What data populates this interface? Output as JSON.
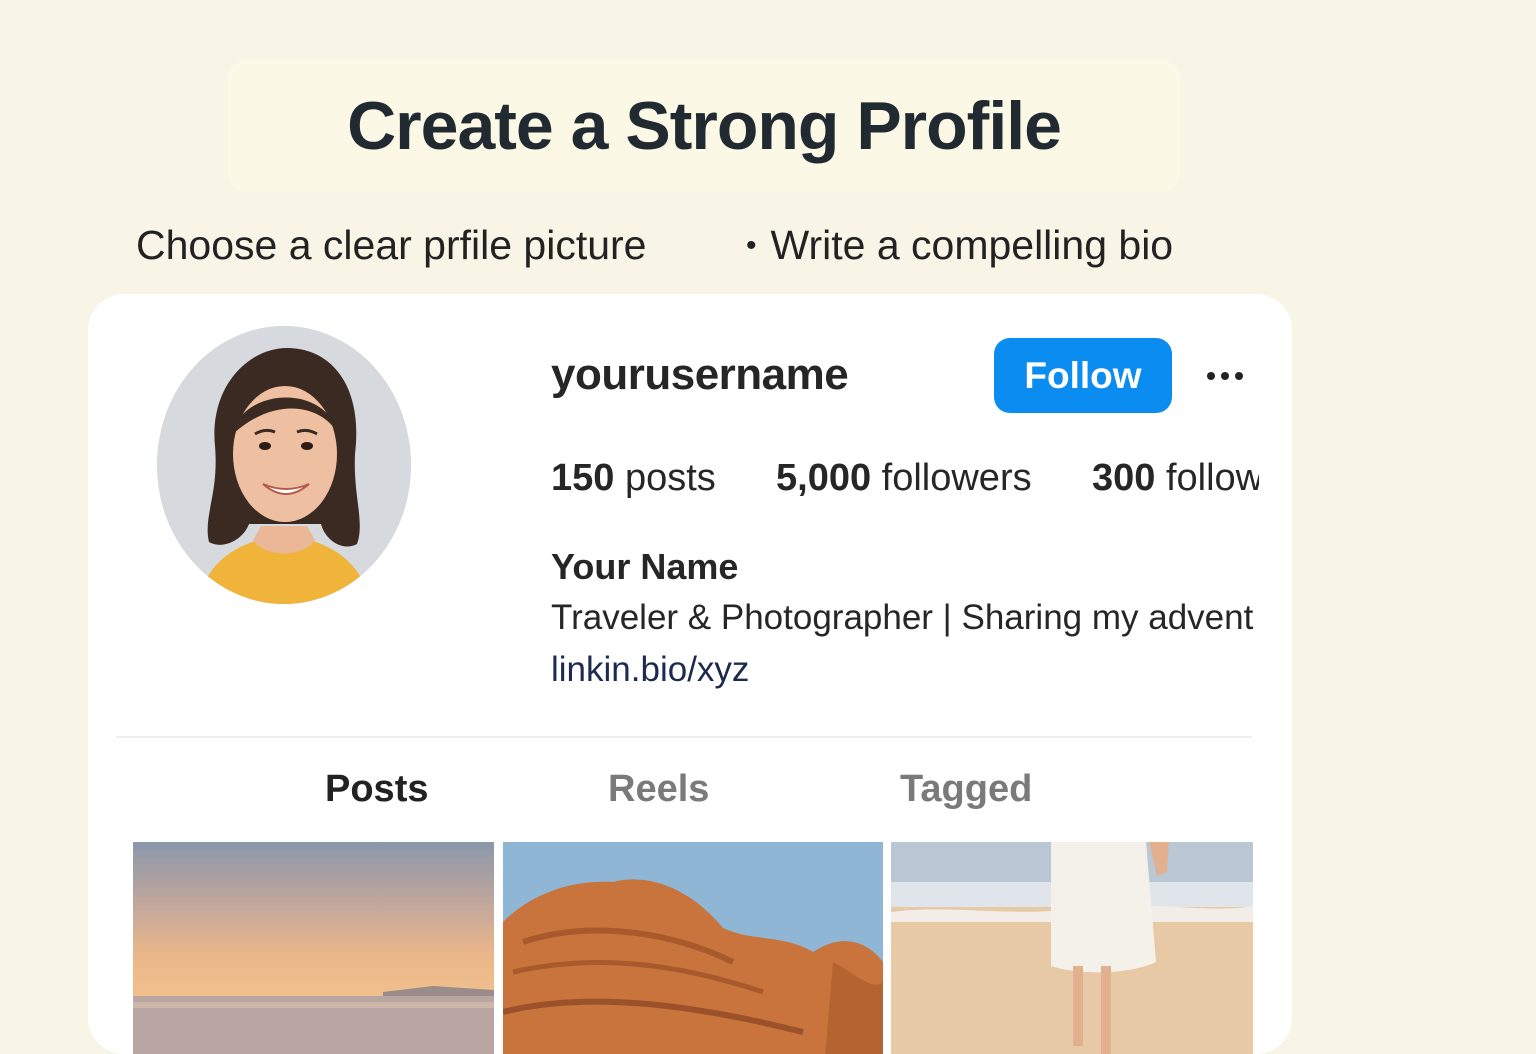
{
  "header": {
    "title": "Create a Strong Profile",
    "tips": [
      "Choose a clear prfile picture",
      "Write a compelling bio"
    ],
    "bullet": "•"
  },
  "profile": {
    "username": "yourusername",
    "follow_label": "Follow",
    "more_label": "more options",
    "stats": [
      {
        "count": "150",
        "label": " posts"
      },
      {
        "count": "5,000",
        "label": " followers"
      },
      {
        "count": "300",
        "label": " following"
      }
    ],
    "name": "Your Name",
    "bio": "Traveler & Photographer | Sharing my adventures",
    "link": "linkin.bio/xyz"
  },
  "tabs": [
    {
      "label": "Posts",
      "active": true
    },
    {
      "label": "Reels",
      "active": false
    },
    {
      "label": "Tagged",
      "active": false
    }
  ],
  "grid": {
    "images": [
      "sunset-sea-photo",
      "red-rock-canyon-photo",
      "beach-walk-photo"
    ]
  },
  "colors": {
    "background": "#f8f4e6",
    "accent": "#0a8cf0",
    "link": "#1b2a4e"
  }
}
